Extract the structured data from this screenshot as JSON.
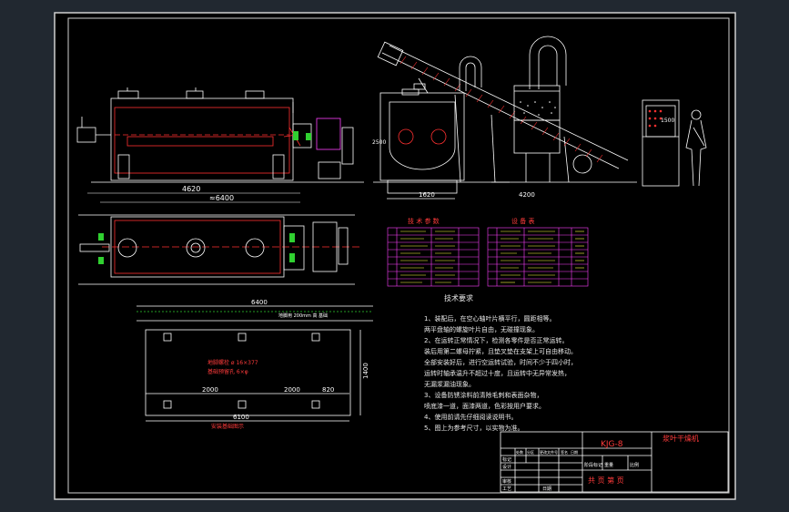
{
  "drawing": {
    "code": "KJG-8",
    "name": "浆叶干燥机",
    "scale_row": "共 页 第 页",
    "dims": {
      "side_total": "≈6400",
      "side_inner": "4620",
      "front_width": "1620",
      "front_height": "2500",
      "plan_right": "4200",
      "foundation_top": "6400",
      "foundation_bottom": "6100",
      "foundation_left": "2000",
      "foundation_mid": "2000",
      "foundation_right": "820",
      "foundation_height": "1400",
      "control_label": "1500"
    },
    "foundation_note_1": "地脚螺栓 ø 16×377",
    "foundation_note_2": "基础预留孔 6×φ",
    "foundation_label": "安装基础图示",
    "foundation_top_label": "地脚用 200mm 高 基础",
    "table1_title": "技 术 参 数",
    "table2_title": "设 备 表",
    "requirements_title": "技术要求",
    "requirements": [
      "1、装配后，在空心轴叶片横平行，圆距相等。",
      "   两平盘轴的螺旋叶片自由，无碰撞现象。",
      "2、在运转正常情况下，检测各零件是否正常运转。",
      "装后用第二螺母拧紧，且垫叉垫在支架上可自由移动。",
      "全部安装好后，进行空运转试验，时间不少于四小时，",
      "运转时轴承温升不超过十度，且运转中无异常发热，",
      "无漏浆漏油现象。",
      "3、设备防锈涂料前清除毛刺和表面杂物，",
      "喷底漆一道，面漆两道，色彩按用户要求。",
      "4、使用前请先仔细阅读说明书。",
      "5、图上为参考尺寸，以实物为准。"
    ],
    "title_block": {
      "row_labels": [
        "标记",
        "设计",
        "审核",
        "工艺"
      ],
      "col_labels": [
        "处数",
        "分区",
        "更改文件号",
        "签名",
        "日期"
      ],
      "stage_labels": [
        "阶段标记",
        "重量",
        "比例"
      ],
      "date_label": "日期"
    },
    "colors": {
      "background": "#212830",
      "sheet": "#000000",
      "line": "#ffffff",
      "red": "#ff2020",
      "magenta": "#ff40ff",
      "yellow": "#ffff40",
      "green": "#30e030"
    }
  }
}
